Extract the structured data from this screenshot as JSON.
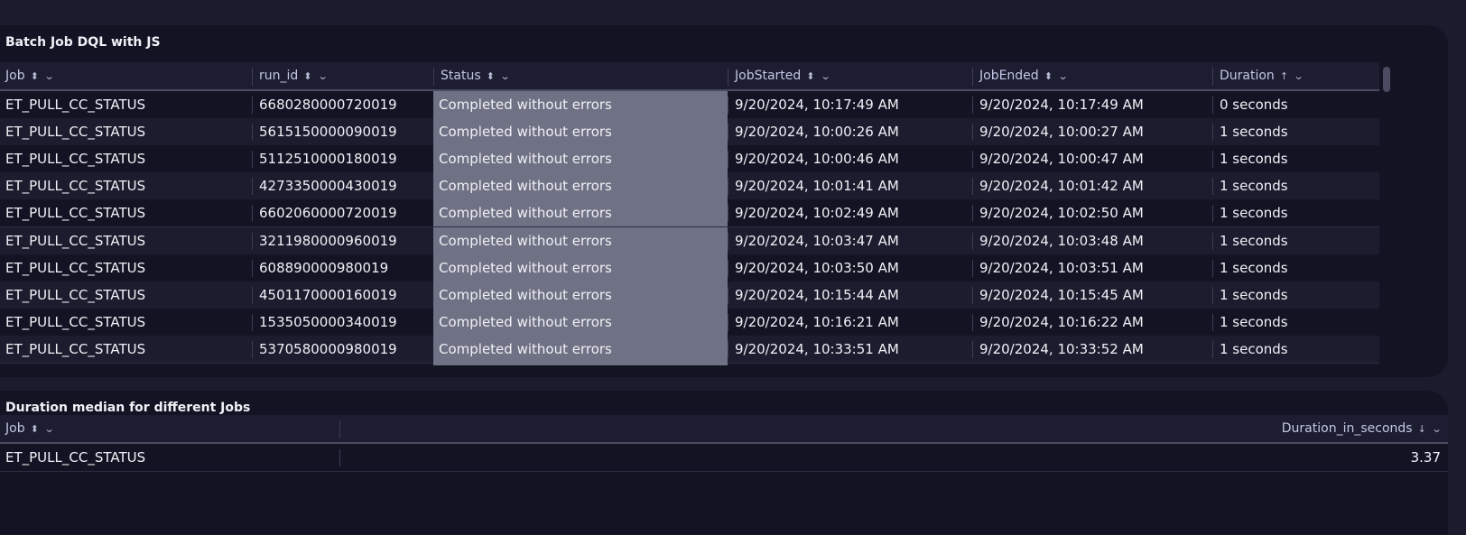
{
  "tile1": {
    "title": "Batch Job DQL with JS",
    "columns": [
      {
        "label": "Job",
        "sort_icon": "sort-both-icon",
        "sort_glyph": "⬍"
      },
      {
        "label": "run_id",
        "sort_icon": "sort-both-icon",
        "sort_glyph": "⬍"
      },
      {
        "label": "Status",
        "sort_icon": "sort-both-icon",
        "sort_glyph": "⬍"
      },
      {
        "label": "JobStarted",
        "sort_icon": "sort-both-icon",
        "sort_glyph": "⬍"
      },
      {
        "label": "JobEnded",
        "sort_icon": "sort-both-icon",
        "sort_glyph": "⬍"
      },
      {
        "label": "Duration",
        "sort_icon": "sort-ascending-icon",
        "sort_glyph": "↑"
      }
    ],
    "menu_glyph": "⌄",
    "rows": [
      {
        "job": "ET_PULL_CC_STATUS",
        "run_id": "6680280000720019",
        "status": "Completed without errors",
        "started": "9/20/2024, 10:17:49 AM",
        "ended": "9/20/2024, 10:17:49 AM",
        "duration": "0 seconds"
      },
      {
        "job": "ET_PULL_CC_STATUS",
        "run_id": "5615150000090019",
        "status": "Completed without errors",
        "started": "9/20/2024, 10:00:26 AM",
        "ended": "9/20/2024, 10:00:27 AM",
        "duration": "1 seconds"
      },
      {
        "job": "ET_PULL_CC_STATUS",
        "run_id": "5112510000180019",
        "status": "Completed without errors",
        "started": "9/20/2024, 10:00:46 AM",
        "ended": "9/20/2024, 10:00:47 AM",
        "duration": "1 seconds"
      },
      {
        "job": "ET_PULL_CC_STATUS",
        "run_id": "4273350000430019",
        "status": "Completed without errors",
        "started": "9/20/2024, 10:01:41 AM",
        "ended": "9/20/2024, 10:01:42 AM",
        "duration": "1 seconds"
      },
      {
        "job": "ET_PULL_CC_STATUS",
        "run_id": "6602060000720019",
        "status": "Completed without errors",
        "started": "9/20/2024, 10:02:49 AM",
        "ended": "9/20/2024, 10:02:50 AM",
        "duration": "1 seconds"
      },
      {
        "job": "ET_PULL_CC_STATUS",
        "run_id": "3211980000960019",
        "status": "Completed without errors",
        "started": "9/20/2024, 10:03:47 AM",
        "ended": "9/20/2024, 10:03:48 AM",
        "duration": "1 seconds"
      },
      {
        "job": "ET_PULL_CC_STATUS",
        "run_id": "608890000980019",
        "status": "Completed without errors",
        "started": "9/20/2024, 10:03:50 AM",
        "ended": "9/20/2024, 10:03:51 AM",
        "duration": "1 seconds"
      },
      {
        "job": "ET_PULL_CC_STATUS",
        "run_id": "4501170000160019",
        "status": "Completed without errors",
        "started": "9/20/2024, 10:15:44 AM",
        "ended": "9/20/2024, 10:15:45 AM",
        "duration": "1 seconds"
      },
      {
        "job": "ET_PULL_CC_STATUS",
        "run_id": "1535050000340019",
        "status": "Completed without errors",
        "started": "9/20/2024, 10:16:21 AM",
        "ended": "9/20/2024, 10:16:22 AM",
        "duration": "1 seconds"
      },
      {
        "job": "ET_PULL_CC_STATUS",
        "run_id": "5370580000980019",
        "status": "Completed without errors",
        "started": "9/20/2024, 10:33:51 AM",
        "ended": "9/20/2024, 10:33:52 AM",
        "duration": "1 seconds"
      }
    ]
  },
  "tile2": {
    "title": "Duration median for different Jobs",
    "columns": [
      {
        "label": "Job",
        "sort_icon": "sort-both-icon",
        "sort_glyph": "⬍"
      },
      {
        "label": "Duration_in_seconds",
        "sort_icon": "sort-descending-icon",
        "sort_glyph": "↓"
      }
    ],
    "menu_glyph": "⌄",
    "rows": [
      {
        "job": "ET_PULL_CC_STATUS",
        "duration_in_seconds": "3.37"
      }
    ]
  },
  "colors": {
    "page_bg": "#1a1b2c",
    "tile_bg": "#131423",
    "status_highlight": "#6f7184",
    "header_text": "#c5c7e6"
  }
}
